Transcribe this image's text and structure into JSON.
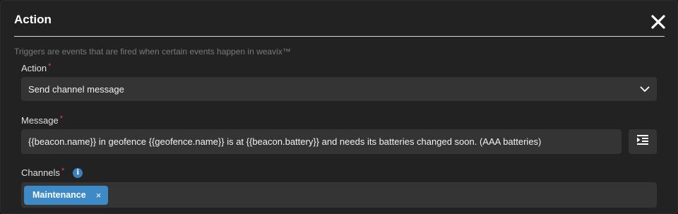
{
  "dialog": {
    "title": "Action",
    "hint": "Triggers are events that are fired when certain events happen in weavix™"
  },
  "action_field": {
    "label": "Action",
    "required_mark": "*",
    "value": "Send channel message"
  },
  "message_field": {
    "label": "Message",
    "required_mark": "*",
    "value": "{{beacon.name}} in geofence {{geofence.name}} is at {{beacon.battery}} and needs its batteries changed soon. (AAA batteries)"
  },
  "channels_field": {
    "label": "Channels",
    "required_mark": "*",
    "info_glyph": "i",
    "chips": [
      {
        "label": "Maintenance",
        "remove": "×"
      }
    ]
  },
  "icons": {
    "close": "close-icon",
    "dropdown": "chevron-down-icon",
    "variables": "insert-variable-icon",
    "info": "info-icon"
  },
  "colors": {
    "accent": "#3d8ac7",
    "required": "#e0454a",
    "background": "#222222",
    "field": "#343434"
  }
}
